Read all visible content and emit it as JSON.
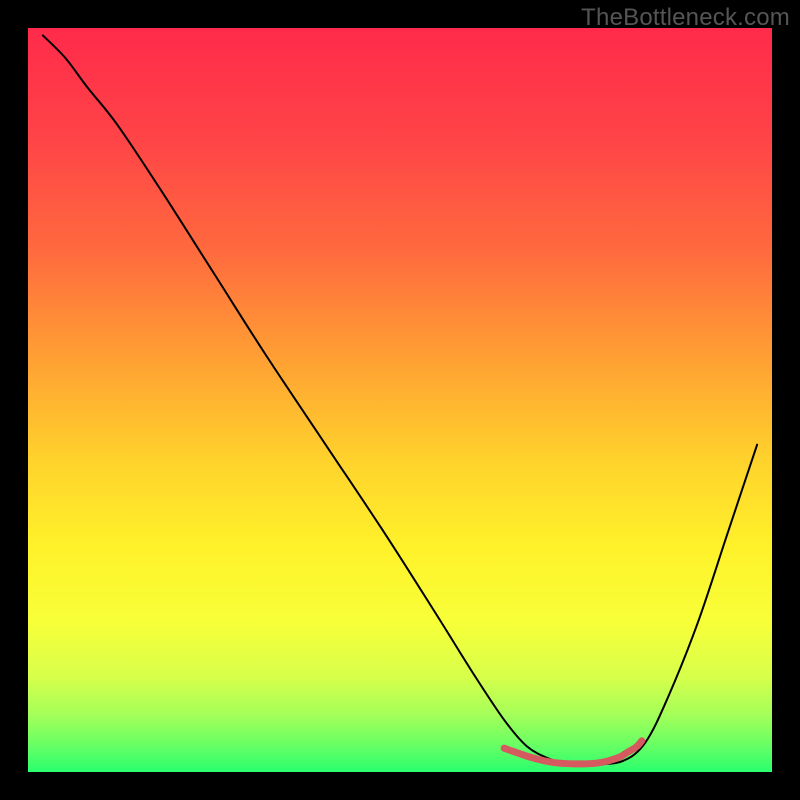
{
  "watermark": "TheBottleneck.com",
  "chart_data": {
    "type": "line",
    "title": "",
    "xlabel": "",
    "ylabel": "",
    "xlim": [
      0,
      100
    ],
    "ylim": [
      0,
      100
    ],
    "grid": false,
    "legend": false,
    "series": [
      {
        "name": "curve-main",
        "color": "#000000",
        "width": 2,
        "x": [
          2,
          5,
          8,
          12,
          18,
          25,
          32,
          40,
          48,
          55,
          60,
          64,
          67,
          70,
          73,
          76,
          80,
          83,
          86,
          90,
          94,
          98
        ],
        "y": [
          99,
          96,
          92,
          87,
          78,
          67,
          56,
          44,
          32,
          21,
          13,
          7,
          3.5,
          1.8,
          1,
          1,
          1.5,
          4,
          10,
          20,
          32,
          44
        ]
      },
      {
        "name": "highlight-bottom",
        "color": "#d55a5f",
        "width": 7,
        "x": [
          64,
          66,
          67.5,
          69,
          70.5,
          72,
          73.5,
          75,
          76.5,
          78,
          79.5,
          80.5,
          81.8,
          82.5
        ],
        "y": [
          3.2,
          2.5,
          2.0,
          1.6,
          1.3,
          1.15,
          1.1,
          1.1,
          1.2,
          1.5,
          2.0,
          2.6,
          3.4,
          4.2
        ]
      }
    ],
    "background_gradient_stops": [
      {
        "offset": 0,
        "color": "#ff2a4a"
      },
      {
        "offset": 0.15,
        "color": "#ff4447"
      },
      {
        "offset": 0.3,
        "color": "#ff6a3e"
      },
      {
        "offset": 0.45,
        "color": "#ffa233"
      },
      {
        "offset": 0.58,
        "color": "#ffd22c"
      },
      {
        "offset": 0.7,
        "color": "#fff22a"
      },
      {
        "offset": 0.8,
        "color": "#f7ff39"
      },
      {
        "offset": 0.87,
        "color": "#d8ff4a"
      },
      {
        "offset": 0.92,
        "color": "#a8ff58"
      },
      {
        "offset": 0.96,
        "color": "#6eff63"
      },
      {
        "offset": 1.0,
        "color": "#2aff6e"
      }
    ]
  }
}
